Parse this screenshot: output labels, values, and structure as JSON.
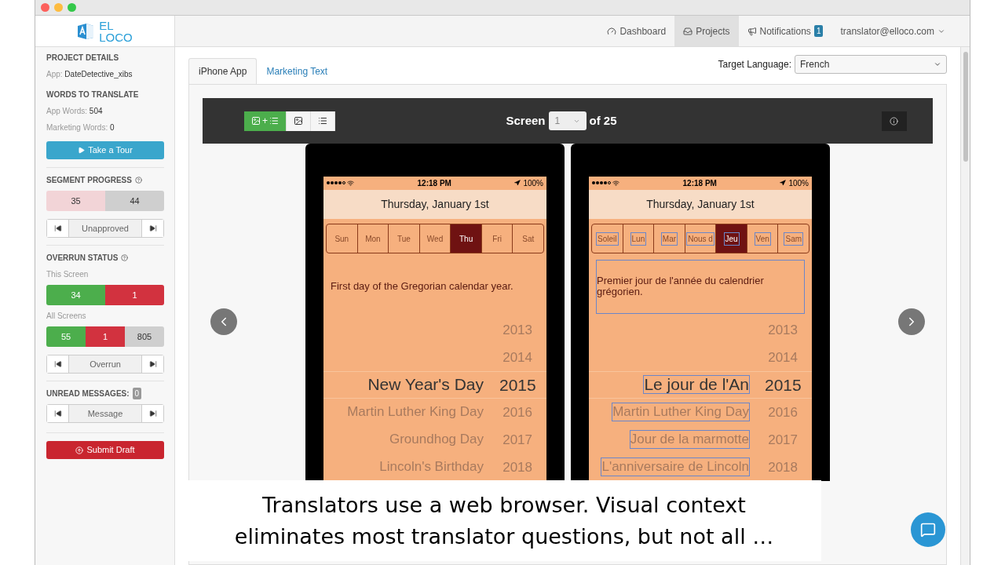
{
  "logo": {
    "line1": "EL",
    "line2": "LOCO"
  },
  "nav": [
    {
      "label": "Dashboard",
      "selected": false
    },
    {
      "label": "Projects",
      "selected": true
    },
    {
      "label": "Notifications",
      "selected": false,
      "badge": "1"
    },
    {
      "label": "translator@elloco.com",
      "selected": false
    }
  ],
  "sidebar": {
    "project_heading": "PROJECT DETAILS",
    "app_label": "App:",
    "app_value": "DateDetective_xibs",
    "words_heading": "WORDS TO TRANSLATE",
    "app_words_label": "App Words:",
    "app_words_value": "504",
    "marketing_words_label": "Marketing Words:",
    "marketing_words_value": "0",
    "tour_button": "Take a Tour",
    "segment_heading": "SEGMENT PROGRESS",
    "segment_bar": [
      {
        "value": "35",
        "color": "#f2d4d7"
      },
      {
        "value": "44",
        "color": "#cfcfcf"
      }
    ],
    "segment_pager": "Unapproved",
    "overrun_heading": "OVERRUN STATUS",
    "this_screen_label": "This Screen",
    "this_screen_bar": [
      {
        "value": "34",
        "color": "#4cae4c"
      },
      {
        "value": "1",
        "color": "#d2323f"
      }
    ],
    "all_screens_label": "All Screens",
    "all_screens_bar": [
      {
        "value": "55",
        "color": "#4cae4c"
      },
      {
        "value": "1",
        "color": "#d2323f"
      },
      {
        "value": "805",
        "color": "#cfcfcf"
      }
    ],
    "overrun_pager": "Overrun",
    "messages_heading": "UNREAD MESSAGES:",
    "messages_count": "0",
    "messages_pager": "Message",
    "submit_button": "Submit Draft"
  },
  "tabs": [
    {
      "label": "iPhone App",
      "selected": true
    },
    {
      "label": "Marketing Text",
      "selected": false
    }
  ],
  "target_language": {
    "label": "Target Language:",
    "value": "French"
  },
  "toolbar": {
    "view_modes": [
      {
        "kind": "both",
        "selected": true
      },
      {
        "kind": "image",
        "selected": false
      },
      {
        "kind": "list",
        "selected": false
      }
    ],
    "plus": "+",
    "screen_label": "Screen",
    "screen_value": "1",
    "of_label": "of 25"
  },
  "phones": [
    {
      "outlined": false,
      "time": "12:18 PM",
      "battery": "100%",
      "date": "Thursday, January 1st",
      "days": [
        {
          "label": "Sun",
          "selected": false
        },
        {
          "label": "Mon",
          "selected": false
        },
        {
          "label": "Tue",
          "selected": false
        },
        {
          "label": "Wed",
          "selected": false
        },
        {
          "label": "Thu",
          "selected": true
        },
        {
          "label": "Fri",
          "selected": false
        },
        {
          "label": "Sat",
          "selected": false
        }
      ],
      "description": "First day of the Gregorian calendar year.",
      "rows": [
        {
          "year": "2013",
          "selected": false
        },
        {
          "year": "2014",
          "selected": false
        },
        {
          "name": "New Year's Day",
          "year": "2015",
          "selected": true
        },
        {
          "name": "Martin Luther King Day",
          "year": "2016",
          "selected": false
        },
        {
          "name": "Groundhog Day",
          "year": "2017",
          "selected": false
        },
        {
          "name": "Lincoln's Birthday",
          "year": "2018",
          "selected": false
        }
      ]
    },
    {
      "outlined": true,
      "time": "12:18 PM",
      "battery": "100%",
      "date": "Thursday, January 1st",
      "days": [
        {
          "label": "Soleil",
          "selected": false
        },
        {
          "label": "Lun",
          "selected": false
        },
        {
          "label": "Mar",
          "selected": false
        },
        {
          "label": "Nous d",
          "selected": false
        },
        {
          "label": "Jeu",
          "selected": true
        },
        {
          "label": "Ven",
          "selected": false
        },
        {
          "label": "Sam",
          "selected": false
        }
      ],
      "description": "Premier jour de l'année du calendrier grégorien.",
      "rows": [
        {
          "year": "2013",
          "selected": false
        },
        {
          "year": "2014",
          "selected": false
        },
        {
          "name": "Le jour de l'An",
          "year": "2015",
          "selected": true
        },
        {
          "name": "Martin Luther King Day",
          "year": "2016",
          "selected": false
        },
        {
          "name": "Jour de la marmotte",
          "year": "2017",
          "selected": false
        },
        {
          "name": "L'anniversaire de Lincoln",
          "year": "2018",
          "selected": false
        }
      ]
    }
  ],
  "caption": {
    "line1": "Translators use a web browser. Visual context",
    "line2": "eliminates most translator questions, but not all …"
  }
}
